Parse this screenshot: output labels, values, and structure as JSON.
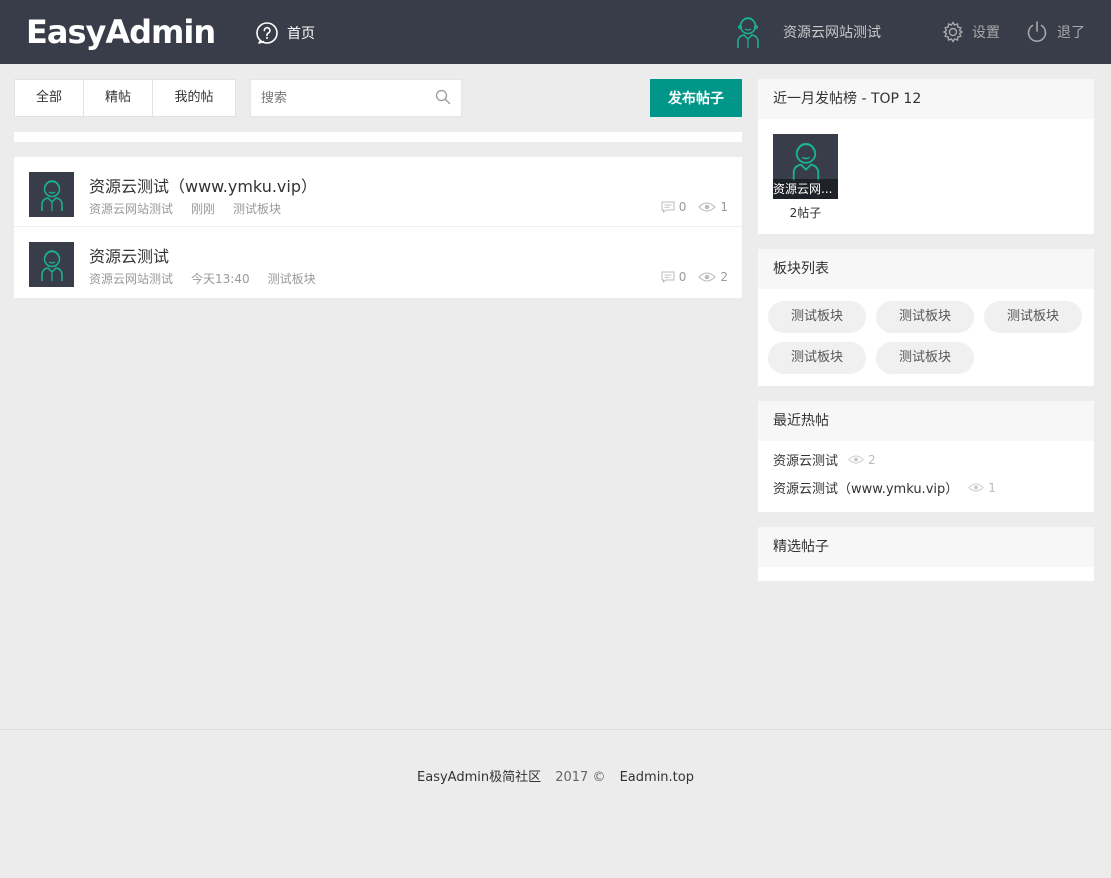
{
  "header": {
    "logo": "EasyAdmin",
    "nav_home": "首页",
    "username": "资源云网站测试",
    "settings": "设置",
    "logout": "退了"
  },
  "toolbar": {
    "tabs": [
      {
        "label": "全部"
      },
      {
        "label": "精帖"
      },
      {
        "label": "我的帖"
      }
    ],
    "search_placeholder": "搜索",
    "publish_label": "发布帖子"
  },
  "posts": [
    {
      "title": "资源云测试（www.ymku.vip）",
      "author": "资源云网站测试",
      "time": "刚刚",
      "category": "测试板块",
      "comments": "0",
      "views": "1"
    },
    {
      "title": "资源云测试",
      "author": "资源云网站测试",
      "time": "今天13:40",
      "category": "测试板块",
      "comments": "0",
      "views": "2"
    }
  ],
  "sidebar": {
    "top_title": "近一月发帖榜 - TOP 12",
    "top_users": [
      {
        "name": "资源云网...",
        "count": "2帖子"
      }
    ],
    "boards_title": "板块列表",
    "boards": [
      "测试板块",
      "测试板块",
      "测试板块",
      "测试板块",
      "测试板块"
    ],
    "hot_title": "最近热帖",
    "hot_posts": [
      {
        "title": "资源云测试",
        "views": "2"
      },
      {
        "title": "资源云测试（www.ymku.vip）",
        "views": "1"
      }
    ],
    "featured_title": "精选帖子"
  },
  "footer": {
    "site": "EasyAdmin极简社区",
    "year": "2017 ©",
    "link": "Eadmin.top"
  },
  "colors": {
    "header_bg": "#393d49",
    "accent": "#009688",
    "page_bg": "#ececec"
  }
}
